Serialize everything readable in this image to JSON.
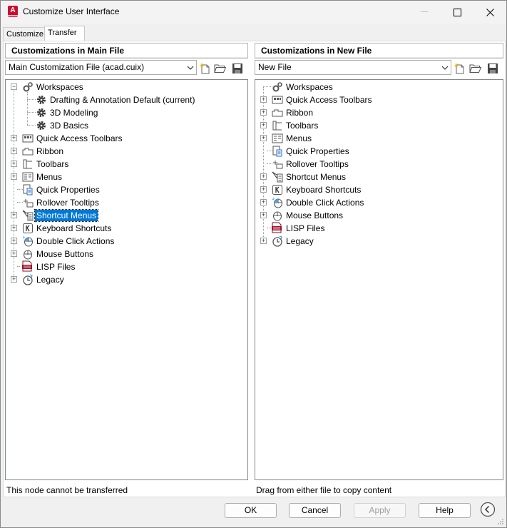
{
  "window": {
    "title": "Customize User Interface",
    "app_icon_letter": "A"
  },
  "tabs": [
    {
      "label": "Customize"
    },
    {
      "label": "Transfer"
    }
  ],
  "left_pane": {
    "header": "Customizations in Main File",
    "file_combo": "Main Customization File (acad.cuix)",
    "status": "This node cannot be transferred",
    "tree": {
      "workspaces": "Workspaces",
      "ws_drafting": "Drafting & Annotation Default (current)",
      "ws_3d_modeling": "3D Modeling",
      "ws_3d_basics": "3D Basics",
      "quick_access_toolbars": "Quick Access Toolbars",
      "ribbon": "Ribbon",
      "toolbars": "Toolbars",
      "menus": "Menus",
      "quick_properties": "Quick Properties",
      "rollover_tooltips": "Rollover Tooltips",
      "shortcut_menus": "Shortcut Menus",
      "keyboard_shortcuts": "Keyboard Shortcuts",
      "double_click_actions": "Double Click Actions",
      "mouse_buttons": "Mouse Buttons",
      "lisp_files": "LISP Files",
      "legacy": "Legacy"
    }
  },
  "right_pane": {
    "header": "Customizations in New File",
    "file_combo": "New File",
    "status": "Drag from either file to copy content",
    "tree": {
      "workspaces": "Workspaces",
      "quick_access_toolbars": "Quick Access Toolbars",
      "ribbon": "Ribbon",
      "toolbars": "Toolbars",
      "menus": "Menus",
      "quick_properties": "Quick Properties",
      "rollover_tooltips": "Rollover Tooltips",
      "shortcut_menus": "Shortcut Menus",
      "keyboard_shortcuts": "Keyboard Shortcuts",
      "double_click_actions": "Double Click Actions",
      "mouse_buttons": "Mouse Buttons",
      "lisp_files": "LISP Files",
      "legacy": "Legacy"
    }
  },
  "buttons": {
    "ok": "OK",
    "cancel": "Cancel",
    "apply": "Apply",
    "help": "Help"
  },
  "colors": {
    "selection": "#0078d7",
    "brand_red": "#c8102e"
  }
}
